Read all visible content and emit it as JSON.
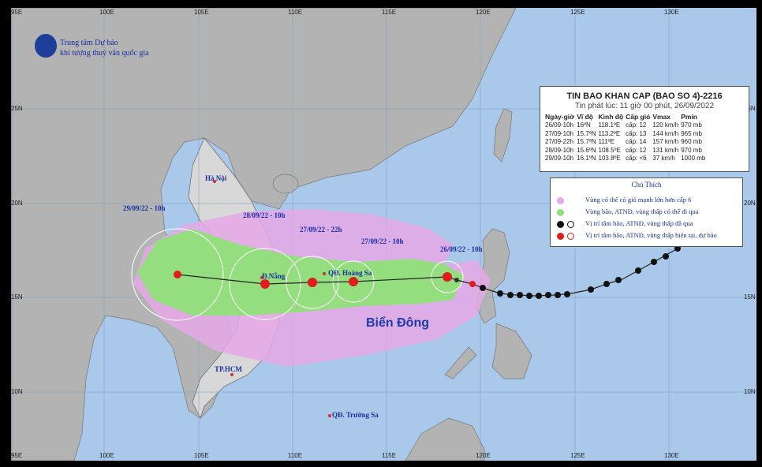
{
  "org": {
    "line1": "Trung tâm Dự báo",
    "line2": "khí tượng thuỷ văn quốc gia"
  },
  "ticks": {
    "lon_top": [
      "95E",
      "100E",
      "105E",
      "110E",
      "115E",
      "120E",
      "125E",
      "130E"
    ],
    "lon_bottom": [
      "95E",
      "100E",
      "105E",
      "110E",
      "115E",
      "120E",
      "125E",
      "130E"
    ],
    "lat_left": [
      "25N",
      "20N",
      "15N",
      "10N"
    ],
    "lat_right": [
      "25N",
      "20N",
      "15N",
      "10N"
    ]
  },
  "places": {
    "hanoi": "Hà Nội",
    "danang": "Đ.Nẵng",
    "hoangsa": "QĐ. Hoàng Sa",
    "hcm": "TP.HCM",
    "truongsa": "QĐ. Trường Sa",
    "sea": "Biển Đông"
  },
  "forecast_labels": {
    "l1": "29/09/22 - 10h",
    "l2": "28/09/22 - 10h",
    "l3": "27/09/22 - 22h",
    "l4": "27/09/22 - 10h",
    "l5": "26/09/22 - 10h"
  },
  "bulletin": {
    "title": "TIN BAO KHAN CAP  (BAO SO 4)-2216",
    "issued": "Tin phát lúc: 11 giờ 00 phút, 26/09/2022",
    "headers": [
      "Ngày-giờ",
      "Vĩ độ",
      "Kinh độ",
      "Cấp gió",
      "Vmax",
      "Pmin"
    ],
    "rows": [
      [
        "26/09-10h",
        "16ºN",
        "118.1ºE",
        "cấp: 12",
        "120 km/h",
        "970 mb"
      ],
      [
        "27/09-10h",
        "15.7ºN",
        "113.2ºE",
        "cấp: 13",
        "144 km/h",
        "965 mb"
      ],
      [
        "27/09-22h",
        "15.7ºN",
        "111ºE",
        "cấp: 14",
        "157 km/h",
        "960 mb"
      ],
      [
        "28/09-10h",
        "15.6ºN",
        "108.5ºE",
        "cấp: 12",
        "131 km/h",
        "970 mb"
      ],
      [
        "29/09-10h",
        "16.1ºN",
        "103.8ºE",
        "cấp: <6",
        "37 km/h",
        "1000 mb"
      ]
    ]
  },
  "legend": {
    "title": "Chú Thích",
    "items": [
      "Vùng có thể có gió mạnh lớn hơn cấp 6",
      "Vùng bão, ATNĐ, vùng thấp có thể đi qua",
      "Vị trí tâm bão, ATNĐ, vùng thấp đã qua",
      "Vị trí tâm bão, ATNĐ, vùng thấp hiện tại, dự báo"
    ]
  },
  "colors": {
    "sea": "#a9c8ea",
    "land": "#b3b3b3",
    "wind_zone": "#e6a8e6",
    "cone": "#8fe07a",
    "storm_red": "#e01c1c",
    "text_blue": "#1a2fa0"
  }
}
